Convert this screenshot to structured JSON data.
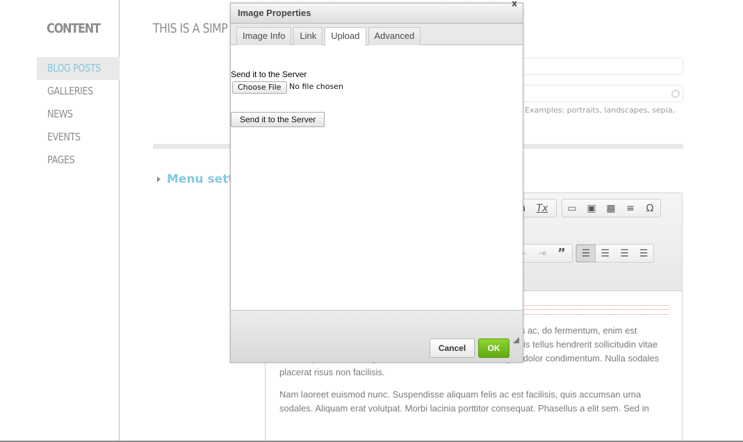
{
  "sidebar": {
    "title": "CONTENT",
    "items": [
      {
        "label": "BLOG POSTS",
        "active": true
      },
      {
        "label": "GALLERIES",
        "active": false
      },
      {
        "label": "NEWS",
        "active": false
      },
      {
        "label": "EVENTS",
        "active": false
      },
      {
        "label": "PAGES",
        "active": false
      }
    ]
  },
  "main": {
    "title": "THIS IS A SIMP",
    "tags_hint": "Examples: portraits, landscapes, sepia,",
    "menu_settings_label": "Menu setti"
  },
  "editor": {
    "toolbar": {
      "group1": [
        {
          "icon": "special-char-icon",
          "glyph": "â"
        },
        {
          "icon": "remove-format-icon",
          "glyph": "Tx"
        }
      ],
      "group2": [
        {
          "icon": "image-icon",
          "glyph": "▭"
        },
        {
          "icon": "flash-icon",
          "glyph": "▣"
        },
        {
          "icon": "table-icon",
          "glyph": "▦"
        },
        {
          "icon": "horizontal-rule-icon",
          "glyph": "≡"
        },
        {
          "icon": "omega-icon",
          "glyph": "Ω"
        }
      ],
      "group3": [
        {
          "icon": "outdent-icon",
          "glyph": "⇤"
        },
        {
          "icon": "indent-icon",
          "glyph": "⇥"
        },
        {
          "icon": "blockquote-icon",
          "glyph": "”"
        }
      ],
      "group4": [
        {
          "icon": "align-left-icon",
          "glyph": "☰",
          "active": true
        },
        {
          "icon": "align-center-icon",
          "glyph": "☰",
          "active": false
        },
        {
          "icon": "align-right-icon",
          "glyph": "☰",
          "active": false
        },
        {
          "icon": "align-justify-icon",
          "glyph": "☰",
          "active": false
        }
      ]
    },
    "paragraphs": [
      "ut lobortis dolor, in sollicitudin c nunc nisi, molestie quis purus ac, do fermentum, enim est molestie lacus, a gravida mauris nisl et leo. Nunc ac tortor quis tellus hendrerit sollicitudin vitae vitae turpis. Nullam fringilla nunc vitae leo ultricies, id feugiat dolor condimentum. Nulla sodales placerat risus non facilisis.",
      "Nam laoreet euismod nunc. Suspendisse aliquam felis ac est facilisis, quis accumsan urna sodales. Aliquam erat volutpat. Morbi lacinia porttitor consequat. Phasellus a elit sem. Sed in"
    ]
  },
  "dialog": {
    "title": "Image Properties",
    "close_glyph": "x",
    "tabs": [
      {
        "label": "Image Info",
        "active": false
      },
      {
        "label": "Link",
        "active": false
      },
      {
        "label": "Upload",
        "active": true
      },
      {
        "label": "Advanced",
        "active": false
      }
    ],
    "upload_label": "Send it to the Server",
    "choose_file_label": "Choose File",
    "no_file_text": "No file chosen",
    "send_button_label": "Send it to the Server",
    "cancel_label": "Cancel",
    "ok_label": "OK"
  }
}
